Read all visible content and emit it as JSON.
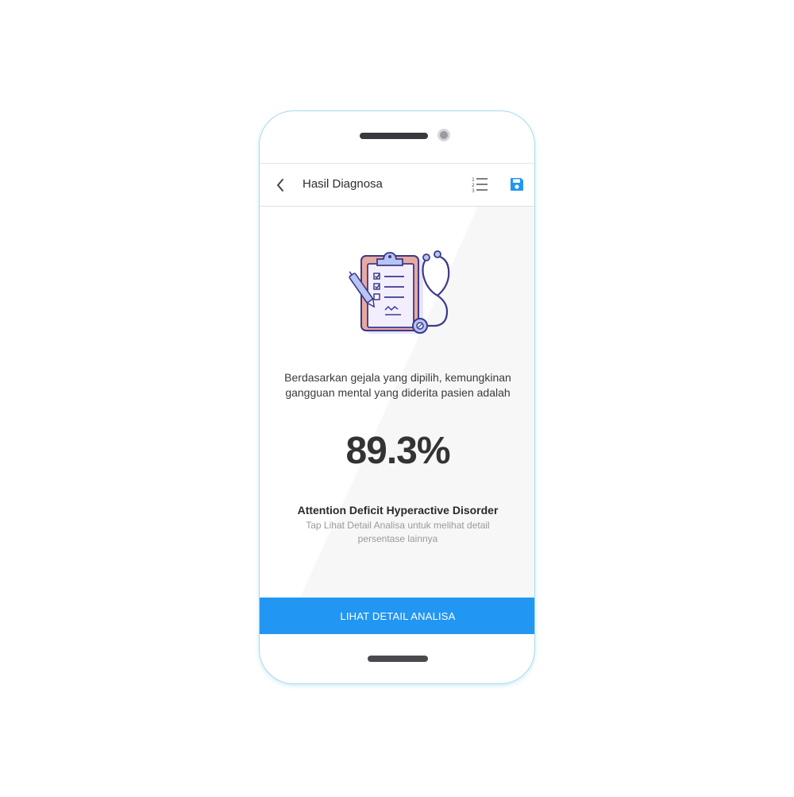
{
  "appbar": {
    "title": "Hasil Diagnosa",
    "back_icon": "chevron-left-icon",
    "list_icon": "numbered-list-icon",
    "save_icon": "floppy-disk-icon"
  },
  "result": {
    "intro": "Berdasarkan gejala yang dipilih, kemungkinan gangguan mental yang diderita pasien adalah",
    "percentage": "89.3%",
    "disorder": "Attention Deficit Hyperactive Disorder",
    "hint": "Tap Lihat Detail Analisa untuk melihat detail persentase lainnya"
  },
  "action": {
    "detail_button": "LIHAT DETAIL ANALISA"
  },
  "colors": {
    "accent": "#2196f3",
    "illustration_primary": "#3a3a8c",
    "illustration_clipboard": "#e8a9a0",
    "illustration_paper": "#f3eefc",
    "phone_frame": "#a6dcea"
  }
}
